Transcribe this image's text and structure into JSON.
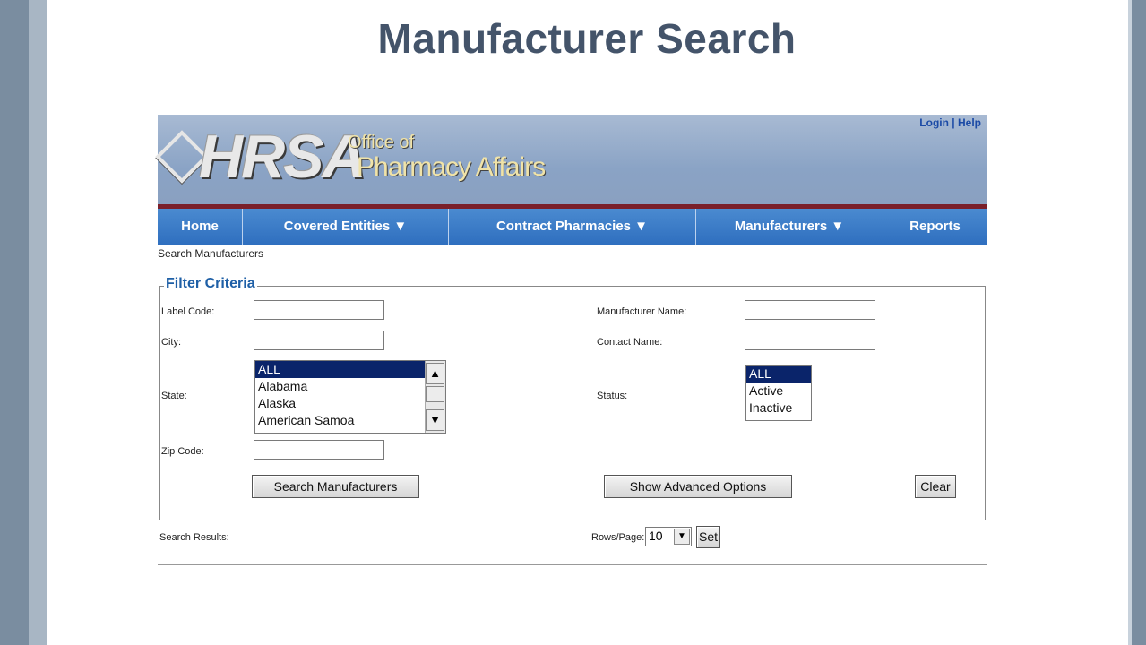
{
  "slide": {
    "title": "Manufacturer Search"
  },
  "header": {
    "links": {
      "login": "Login",
      "separator": "|",
      "help": "Help"
    },
    "logo": {
      "main": "HRSA",
      "line1": "Office of",
      "line2": "Pharmacy Affairs"
    }
  },
  "nav": {
    "items": [
      {
        "label": "Home"
      },
      {
        "label": "Covered Entities ▼"
      },
      {
        "label": "Contract Pharmacies ▼"
      },
      {
        "label": "Manufacturers ▼"
      },
      {
        "label": "Reports"
      }
    ]
  },
  "breadcrumb": "Search Manufacturers",
  "filter": {
    "legend": "Filter Criteria",
    "label_code": {
      "label": "Label Code:",
      "value": ""
    },
    "manufacturer_name": {
      "label": "Manufacturer Name:",
      "value": ""
    },
    "city": {
      "label": "City:",
      "value": ""
    },
    "contact_name": {
      "label": "Contact Name:",
      "value": ""
    },
    "state": {
      "label": "State:",
      "options": [
        "ALL",
        "Alabama",
        "Alaska",
        "American Samoa"
      ],
      "selected": "ALL"
    },
    "status": {
      "label": "Status:",
      "options": [
        "ALL",
        "Active",
        "Inactive"
      ],
      "selected": "ALL"
    },
    "zip_code": {
      "label": "Zip Code:",
      "value": ""
    },
    "buttons": {
      "search": "Search Manufacturers",
      "advanced": "Show Advanced Options",
      "clear": "Clear"
    }
  },
  "results": {
    "label": "Search Results:",
    "rows_label": "Rows/Page:",
    "rows_value": "10",
    "set_button": "Set"
  },
  "colors": {
    "title": "#44546a",
    "nav": "#2f6fbf",
    "banner": "#8aa3c5",
    "accent_bar": "#7a1f2a",
    "legend": "#1e5fa6",
    "selected_option": "#0a246a"
  }
}
